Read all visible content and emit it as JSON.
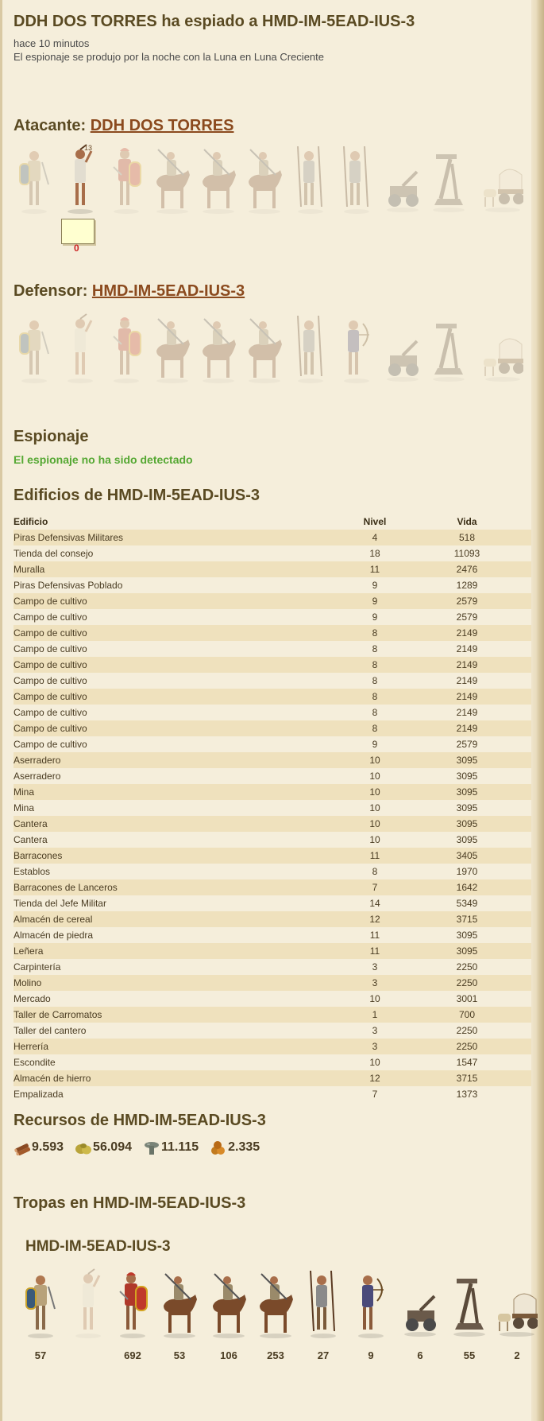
{
  "report": {
    "title": "DDH DOS TORRES ha espiado a HMD-IM-5EAD-IUS-3",
    "time": "hace 10 minutos",
    "moon": "El espionaje se produjo por la noche con la Luna en Luna Creciente"
  },
  "attacker": {
    "label": "Atacante:",
    "name": "DDH DOS TORRES",
    "unit_badge": "13",
    "sent_count": "0"
  },
  "defender": {
    "label": "Defensor:",
    "name": "HMD-IM-5EAD-IUS-3"
  },
  "spy": {
    "heading": "Espionaje",
    "status": "El espionaje no ha sido detectado"
  },
  "buildings": {
    "heading": "Edificios de HMD-IM-5EAD-IUS-3",
    "columns": [
      "Edificio",
      "Nivel",
      "Vida"
    ],
    "rows": [
      [
        "Piras Defensivas Militares",
        "4",
        "518"
      ],
      [
        "Tienda del consejo",
        "18",
        "11093"
      ],
      [
        "Muralla",
        "11",
        "2476"
      ],
      [
        "Piras Defensivas Poblado",
        "9",
        "1289"
      ],
      [
        "Campo de cultivo",
        "9",
        "2579"
      ],
      [
        "Campo de cultivo",
        "9",
        "2579"
      ],
      [
        "Campo de cultivo",
        "8",
        "2149"
      ],
      [
        "Campo de cultivo",
        "8",
        "2149"
      ],
      [
        "Campo de cultivo",
        "8",
        "2149"
      ],
      [
        "Campo de cultivo",
        "8",
        "2149"
      ],
      [
        "Campo de cultivo",
        "8",
        "2149"
      ],
      [
        "Campo de cultivo",
        "8",
        "2149"
      ],
      [
        "Campo de cultivo",
        "8",
        "2149"
      ],
      [
        "Campo de cultivo",
        "9",
        "2579"
      ],
      [
        "Aserradero",
        "10",
        "3095"
      ],
      [
        "Aserradero",
        "10",
        "3095"
      ],
      [
        "Mina",
        "10",
        "3095"
      ],
      [
        "Mina",
        "10",
        "3095"
      ],
      [
        "Cantera",
        "10",
        "3095"
      ],
      [
        "Cantera",
        "10",
        "3095"
      ],
      [
        "Barracones",
        "11",
        "3405"
      ],
      [
        "Establos",
        "8",
        "1970"
      ],
      [
        "Barracones de Lanceros",
        "7",
        "1642"
      ],
      [
        "Tienda del Jefe Militar",
        "14",
        "5349"
      ],
      [
        "Almacén de cereal",
        "12",
        "3715"
      ],
      [
        "Almacén de piedra",
        "11",
        "3095"
      ],
      [
        "Leñera",
        "11",
        "3095"
      ],
      [
        "Carpintería",
        "3",
        "2250"
      ],
      [
        "Molino",
        "3",
        "2250"
      ],
      [
        "Mercado",
        "10",
        "3001"
      ],
      [
        "Taller de Carromatos",
        "1",
        "700"
      ],
      [
        "Taller del cantero",
        "3",
        "2250"
      ],
      [
        "Herrería",
        "3",
        "2250"
      ],
      [
        "Escondite",
        "10",
        "1547"
      ],
      [
        "Almacén de hierro",
        "12",
        "3715"
      ],
      [
        "Empalizada",
        "7",
        "1373"
      ]
    ]
  },
  "resources": {
    "heading": "Recursos de HMD-IM-5EAD-IUS-3",
    "items": [
      {
        "icon": "wood-icon",
        "value": "9.593"
      },
      {
        "icon": "cereal-icon",
        "value": "56.094"
      },
      {
        "icon": "stone-icon",
        "value": "11.115"
      },
      {
        "icon": "iron-icon",
        "value": "2.335"
      }
    ]
  },
  "troops": {
    "heading": "Tropas en HMD-IM-5EAD-IUS-3",
    "village": "HMD-IM-5EAD-IUS-3",
    "counts": [
      "57",
      "",
      "692",
      "53",
      "106",
      "253",
      "27",
      "9",
      "6",
      "55",
      "2"
    ]
  },
  "colors": {
    "background": "#f5eedb",
    "row_alt": "#efe1bd",
    "link": "#8b4a1e",
    "success": "#55a833",
    "alert": "#cc2222"
  }
}
